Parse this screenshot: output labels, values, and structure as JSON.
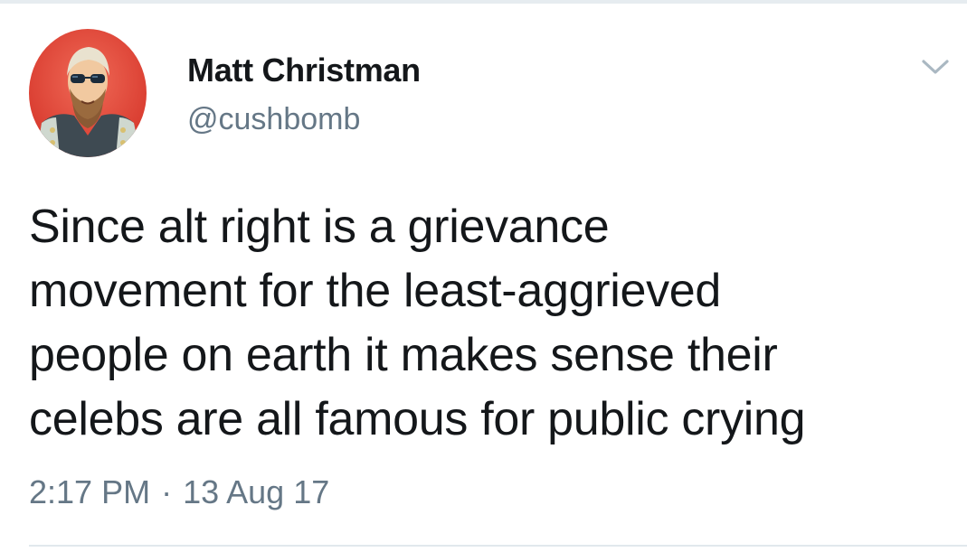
{
  "tweet": {
    "author": {
      "display_name": "Matt Christman",
      "handle": "@cushbomb",
      "avatar_icon": "profile-photo-avatar"
    },
    "text": "Since alt right is a grievance\nmovement for the least-aggrieved\npeople on earth it makes sense their\ncelebs are all famous for public crying",
    "time": "2:17 PM",
    "separator": "·",
    "date": "13 Aug 17",
    "menu_icon": "chevron-down-icon"
  },
  "colors": {
    "text_primary": "#14171a",
    "text_secondary": "#657786",
    "caret": "#aab8c2",
    "divider": "#e1e8ed",
    "avatar_background": "#e8463a"
  }
}
